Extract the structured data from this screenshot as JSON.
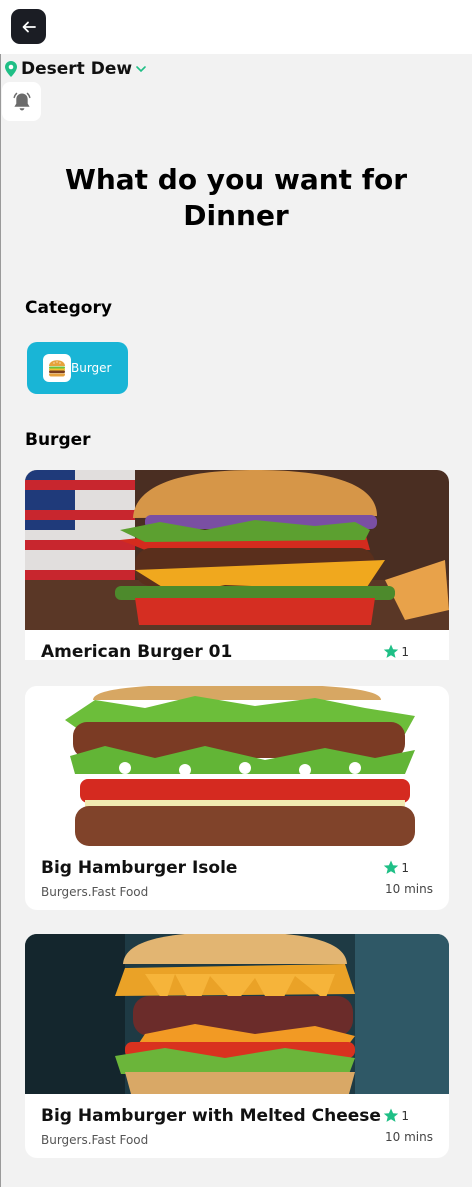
{
  "header": {
    "location": "Desert Dew"
  },
  "headline": "What do you want for Dinner",
  "category": {
    "title": "Category",
    "chips": [
      {
        "label": "Burger",
        "icon": "burger-icon"
      }
    ]
  },
  "list": {
    "title": "Burger",
    "items": [
      {
        "title": "American Burger 01",
        "subtitle": "",
        "rating": "1",
        "time": ""
      },
      {
        "title": "Big Hamburger Isole",
        "subtitle": "Burgers.Fast Food",
        "rating": "1",
        "time": "10 mins"
      },
      {
        "title": "Big Hamburger with Melted Cheese",
        "subtitle": "Burgers.Fast Food",
        "rating": "1",
        "time": "10 mins"
      }
    ]
  },
  "colors": {
    "accent": "#19b5d6",
    "star": "#1fbf86",
    "location_pin": "#1fbf86",
    "back_button": "#1b1d24"
  }
}
